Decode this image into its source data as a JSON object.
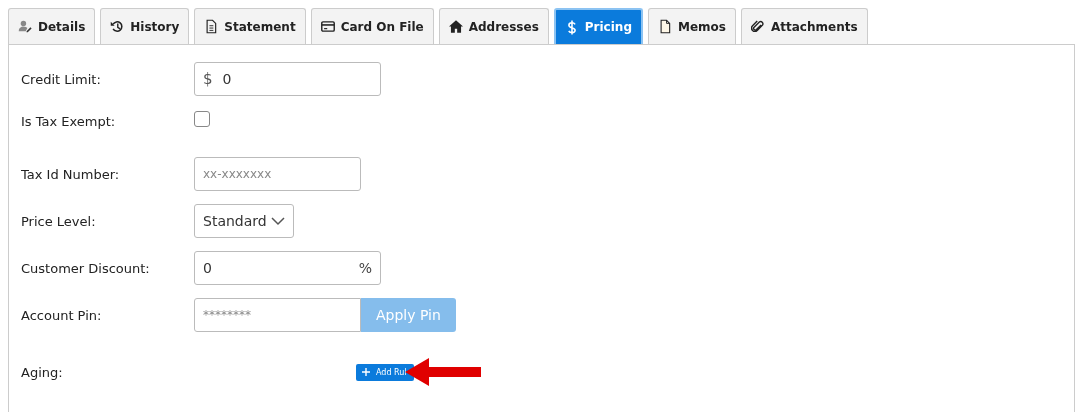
{
  "tabs": [
    {
      "label": "Details",
      "selected": false
    },
    {
      "label": "History",
      "selected": false
    },
    {
      "label": "Statement",
      "selected": false
    },
    {
      "label": "Card On File",
      "selected": false
    },
    {
      "label": "Addresses",
      "selected": false
    },
    {
      "label": "Pricing",
      "selected": true
    },
    {
      "label": "Memos",
      "selected": false
    },
    {
      "label": "Attachments",
      "selected": false
    }
  ],
  "fields": [
    {
      "kind": "currency",
      "label": "Credit Limit:",
      "prefix": "$",
      "value": "0"
    },
    {
      "kind": "checkbox",
      "label": "Is Tax Exempt:",
      "checked": false
    },
    {
      "kind": "text",
      "label": "Tax Id Number:",
      "placeholder": "xx-xxxxxxx"
    },
    {
      "kind": "select",
      "label": "Price Level:",
      "value": "Standard"
    },
    {
      "kind": "percent",
      "label": "Customer Discount:",
      "value": "0",
      "suffix": "%"
    },
    {
      "kind": "pin",
      "label": "Account Pin:",
      "placeholder": "********",
      "button": {
        "label": "Apply Pin",
        "disabled": true
      }
    },
    {
      "kind": "rule",
      "label": "Aging:",
      "button": {
        "label": "Add Rul"
      }
    }
  ]
}
